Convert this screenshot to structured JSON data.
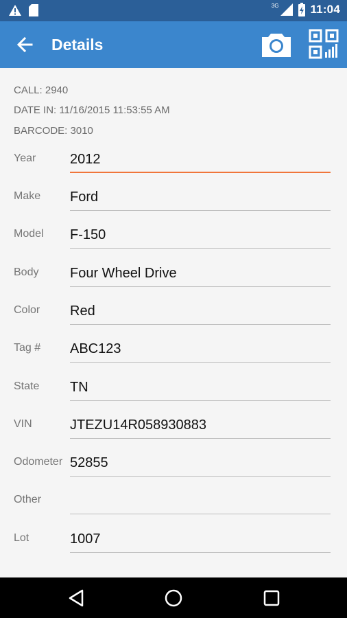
{
  "status_bar": {
    "time": "11:04",
    "network": "3G",
    "icons": [
      "warning-icon",
      "sd-card-icon",
      "signal-icon",
      "battery-icon"
    ]
  },
  "app_bar": {
    "title": "Details",
    "icons": [
      "back-arrow-icon",
      "camera-icon",
      "qr-code-icon"
    ]
  },
  "summary": {
    "call": "CALL: 2940",
    "date_in": "DATE IN: 11/16/2015 11:53:55 AM",
    "barcode": "BARCODE: 3010"
  },
  "fields": [
    {
      "label": "Year",
      "value": "2012"
    },
    {
      "label": "Make",
      "value": "Ford"
    },
    {
      "label": "Model",
      "value": "F-150"
    },
    {
      "label": "Body",
      "value": "Four Wheel Drive"
    },
    {
      "label": "Color",
      "value": "Red"
    },
    {
      "label": "Tag #",
      "value": "ABC123"
    },
    {
      "label": "State",
      "value": "TN"
    },
    {
      "label": "VIN",
      "value": "JTEZU14R058930883"
    },
    {
      "label": "Odometer",
      "value": "52855"
    },
    {
      "label": "Other",
      "value": ""
    },
    {
      "label": "Lot",
      "value": "1007"
    }
  ],
  "colors": {
    "status_bar": "#2b5f98",
    "app_bar": "#3b86cd",
    "active_underline": "#f0753a"
  },
  "nav_bar": {
    "icons": [
      "back-triangle-icon",
      "home-circle-icon",
      "recents-square-icon"
    ]
  }
}
